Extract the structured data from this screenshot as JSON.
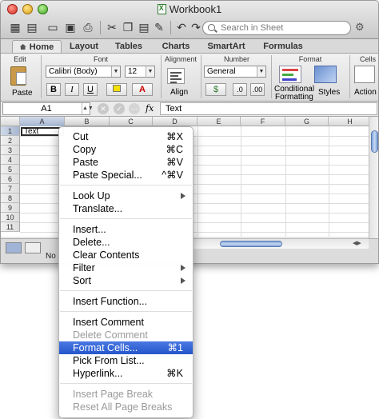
{
  "window": {
    "title": "Workbook1"
  },
  "search": {
    "placeholder": "Search in Sheet"
  },
  "ribbon_tabs": [
    "Home",
    "Layout",
    "Tables",
    "Charts",
    "SmartArt",
    "Formulas"
  ],
  "ribbon": {
    "groups": {
      "edit": "Edit",
      "font": "Font",
      "alignment": "Alignment",
      "number": "Number",
      "format": "Format",
      "cells": "Cells"
    },
    "paste_label": "Paste",
    "font_name": "Calibri (Body)",
    "font_size": "12",
    "bold": "B",
    "italic": "I",
    "underline": "U",
    "align_label": "Align",
    "number_format": "General",
    "conditional_formatting": [
      "Conditional",
      "Formatting"
    ],
    "styles_label": "Styles",
    "actions_label": "Action"
  },
  "formula_bar": {
    "cell_ref": "A1",
    "fx": "fx",
    "value": "Text"
  },
  "grid": {
    "columns": [
      "A",
      "B",
      "C",
      "D",
      "E",
      "F",
      "G",
      "H"
    ],
    "rows": [
      "1",
      "2",
      "3",
      "4",
      "5",
      "6",
      "7",
      "8",
      "9",
      "10",
      "11"
    ],
    "a1_value": "Text"
  },
  "status": {
    "text": "No"
  },
  "context_menu": [
    {
      "label": "Cut",
      "shortcut": "⌘X"
    },
    {
      "label": "Copy",
      "shortcut": "⌘C"
    },
    {
      "label": "Paste",
      "shortcut": "⌘V"
    },
    {
      "label": "Paste Special...",
      "shortcut": "^⌘V"
    },
    {
      "label": "Look Up",
      "submenu": true
    },
    {
      "label": "Translate..."
    },
    {
      "label": "Insert..."
    },
    {
      "label": "Delete..."
    },
    {
      "label": "Clear Contents"
    },
    {
      "label": "Filter",
      "submenu": true
    },
    {
      "label": "Sort",
      "submenu": true
    },
    {
      "label": "Insert Function..."
    },
    {
      "label": "Insert Comment"
    },
    {
      "label": "Delete Comment",
      "disabled": true
    },
    {
      "label": "Format Cells...",
      "shortcut": "⌘1",
      "highlighted": true
    },
    {
      "label": "Pick From List..."
    },
    {
      "label": "Hyperlink...",
      "shortcut": "⌘K"
    },
    {
      "label": "Insert Page Break",
      "disabled": true
    },
    {
      "label": "Reset All Page Breaks",
      "disabled": true
    }
  ],
  "colors": {
    "highlight": "#2f63d6",
    "selection_header": "#a7b6d0"
  }
}
